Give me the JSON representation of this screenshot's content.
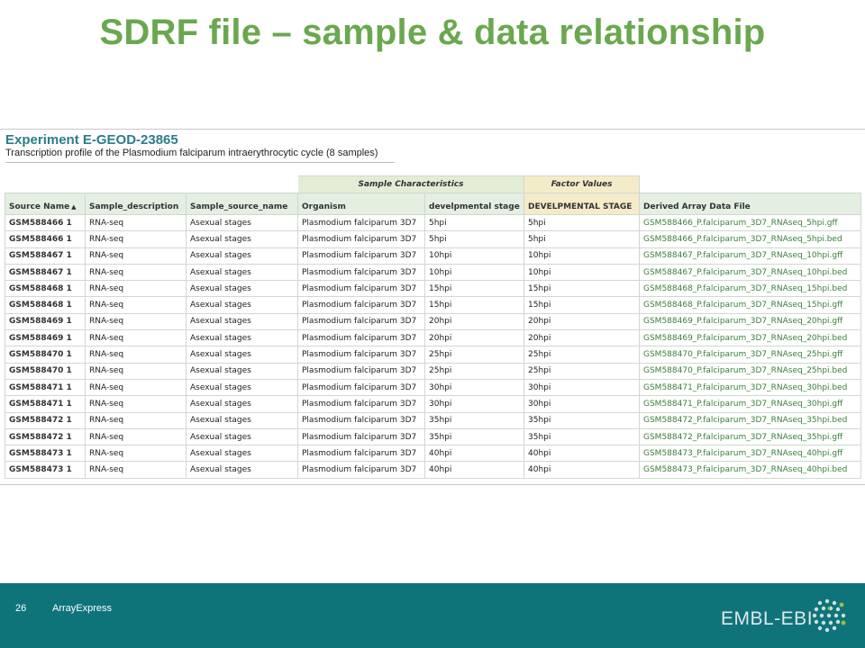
{
  "slide": {
    "title": "SDRF file – sample & data relationship"
  },
  "experiment": {
    "title": "Experiment E-GEOD-23865",
    "subtitle": "Transcription profile of the Plasmodium falciparum intraerythrocytic cycle (8 samples)"
  },
  "table": {
    "groups": {
      "sample_characteristics": "Sample Characteristics",
      "factor_values": "Factor Values"
    },
    "columns": [
      "Source Name",
      "Sample_description",
      "Sample_source_name",
      "Organism",
      "develpmental stage",
      "DEVELPMENTAL STAGE",
      "Derived Array Data File"
    ],
    "sort_indicator": "▲",
    "rows": [
      [
        "GSM588466 1",
        "RNA-seq",
        "Asexual stages",
        "Plasmodium falciparum 3D7",
        "5hpi",
        "5hpi",
        "GSM588466_P.falciparum_3D7_RNAseq_5hpi.gff"
      ],
      [
        "GSM588466 1",
        "RNA-seq",
        "Asexual stages",
        "Plasmodium falciparum 3D7",
        "5hpi",
        "5hpi",
        "GSM588466_P.falciparum_3D7_RNAseq_5hpi.bed"
      ],
      [
        "GSM588467 1",
        "RNA-seq",
        "Asexual stages",
        "Plasmodium falciparum 3D7",
        "10hpi",
        "10hpi",
        "GSM588467_P.falciparum_3D7_RNAseq_10hpi.gff"
      ],
      [
        "GSM588467 1",
        "RNA-seq",
        "Asexual stages",
        "Plasmodium falciparum 3D7",
        "10hpi",
        "10hpi",
        "GSM588467_P.falciparum_3D7_RNAseq_10hpi.bed"
      ],
      [
        "GSM588468 1",
        "RNA-seq",
        "Asexual stages",
        "Plasmodium falciparum 3D7",
        "15hpi",
        "15hpi",
        "GSM588468_P.falciparum_3D7_RNAseq_15hpi.bed"
      ],
      [
        "GSM588468 1",
        "RNA-seq",
        "Asexual stages",
        "Plasmodium falciparum 3D7",
        "15hpi",
        "15hpi",
        "GSM588468_P.falciparum_3D7_RNAseq_15hpi.gff"
      ],
      [
        "GSM588469 1",
        "RNA-seq",
        "Asexual stages",
        "Plasmodium falciparum 3D7",
        "20hpi",
        "20hpi",
        "GSM588469_P.falciparum_3D7_RNAseq_20hpi.gff"
      ],
      [
        "GSM588469 1",
        "RNA-seq",
        "Asexual stages",
        "Plasmodium falciparum 3D7",
        "20hpi",
        "20hpi",
        "GSM588469_P.falciparum_3D7_RNAseq_20hpi.bed"
      ],
      [
        "GSM588470 1",
        "RNA-seq",
        "Asexual stages",
        "Plasmodium falciparum 3D7",
        "25hpi",
        "25hpi",
        "GSM588470_P.falciparum_3D7_RNAseq_25hpi.gff"
      ],
      [
        "GSM588470 1",
        "RNA-seq",
        "Asexual stages",
        "Plasmodium falciparum 3D7",
        "25hpi",
        "25hpi",
        "GSM588470_P.falciparum_3D7_RNAseq_25hpi.bed"
      ],
      [
        "GSM588471 1",
        "RNA-seq",
        "Asexual stages",
        "Plasmodium falciparum 3D7",
        "30hpi",
        "30hpi",
        "GSM588471_P.falciparum_3D7_RNAseq_30hpi.bed"
      ],
      [
        "GSM588471 1",
        "RNA-seq",
        "Asexual stages",
        "Plasmodium falciparum 3D7",
        "30hpi",
        "30hpi",
        "GSM588471_P.falciparum_3D7_RNAseq_30hpi.gff"
      ],
      [
        "GSM588472 1",
        "RNA-seq",
        "Asexual stages",
        "Plasmodium falciparum 3D7",
        "35hpi",
        "35hpi",
        "GSM588472_P.falciparum_3D7_RNAseq_35hpi.bed"
      ],
      [
        "GSM588472 1",
        "RNA-seq",
        "Asexual stages",
        "Plasmodium falciparum 3D7",
        "35hpi",
        "35hpi",
        "GSM588472_P.falciparum_3D7_RNAseq_35hpi.gff"
      ],
      [
        "GSM588473 1",
        "RNA-seq",
        "Asexual stages",
        "Plasmodium falciparum 3D7",
        "40hpi",
        "40hpi",
        "GSM588473_P.falciparum_3D7_RNAseq_40hpi.gff"
      ],
      [
        "GSM588473 1",
        "RNA-seq",
        "Asexual stages",
        "Plasmodium falciparum 3D7",
        "40hpi",
        "40hpi",
        "GSM588473_P.falciparum_3D7_RNAseq_40hpi.bed"
      ]
    ]
  },
  "footer": {
    "page_number": "26",
    "label": "ArrayExpress",
    "brand": "EMBL-EBI"
  },
  "colors": {
    "title_green": "#6aa84f",
    "footer_teal": "#0f747a",
    "link_green": "#3a7f3a",
    "header_blue": "#2c7c8a"
  },
  "icons": {
    "sort": "sort-ascending-icon",
    "logo": "embl-ebi-logo-icon"
  }
}
